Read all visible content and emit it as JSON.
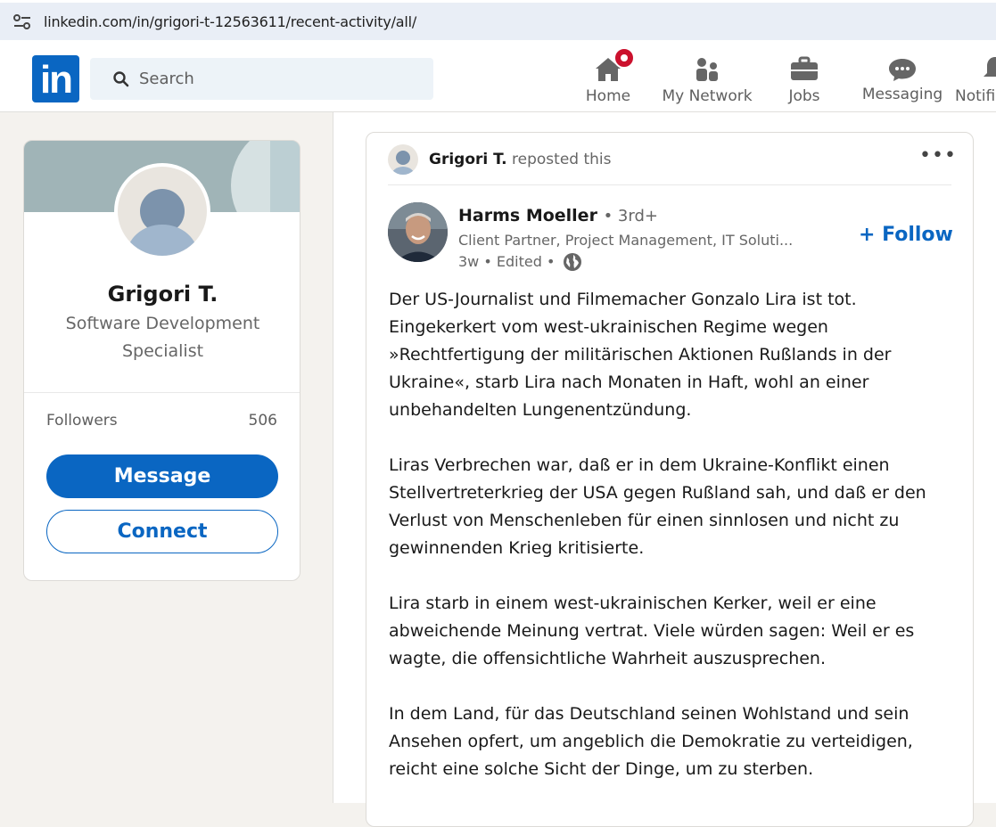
{
  "browser": {
    "url": "linkedin.com/in/grigori-t-12563611/recent-activity/all/",
    "site_info_icon": "tune-icon"
  },
  "nav": {
    "logo": "in",
    "search": {
      "placeholder": "Search",
      "value": ""
    },
    "items": [
      {
        "label": "Home",
        "icon": "home-icon",
        "badge": true
      },
      {
        "label": "My Network",
        "icon": "network-icon"
      },
      {
        "label": "Jobs",
        "icon": "briefcase-icon"
      },
      {
        "label": "Messaging",
        "icon": "messaging-icon"
      },
      {
        "label": "Notifi",
        "icon": "bell-icon"
      }
    ]
  },
  "profile": {
    "name": "Grigori T.",
    "headline": "Software Development Specialist",
    "followers_label": "Followers",
    "followers_count": "506",
    "message_label": "Message",
    "connect_label": "Connect"
  },
  "post": {
    "reposter": "Grigori T.",
    "repost_text": "reposted this",
    "more_label": "•••",
    "author": {
      "name": "Harms Moeller",
      "degree": "• 3rd+",
      "headline": "Client Partner, Project Management, IT Soluti...",
      "meta": "3w • Edited •"
    },
    "follow_label": "+ Follow",
    "paragraphs": [
      "Der US-Journalist und Filmemacher Gonzalo Lira ist tot. Eingekerkert vom west-ukrainischen Regime wegen »Rechtfertigung der militärischen Aktionen Rußlands in der Ukraine«, starb Lira nach Monaten in Haft, wohl an einer unbehandelten Lungenentzündung.",
      "Liras Verbrechen war, daß er in dem Ukraine-Konflikt einen Stellvertreterkrieg der USA gegen Rußland sah, und daß er den Verlust von Menschenleben für einen sinnlosen und nicht zu gewinnenden Krieg kritisierte.",
      "Lira starb in einem west-ukrainischen Kerker, weil er eine abweichende Meinung vertrat. Viele würden sagen: Weil er es wagte, die offensichtliche Wahrheit auszusprechen.",
      "In dem Land, für das Deutschland seinen Wohlstand und sein Ansehen opfert, um angeblich die Demokratie zu verteidigen, reicht eine solche Sicht der Dinge, um zu sterben."
    ]
  },
  "colors": {
    "brand": "#0a66c2",
    "badge": "#cb112d",
    "page_bg": "#f4f2ee"
  }
}
